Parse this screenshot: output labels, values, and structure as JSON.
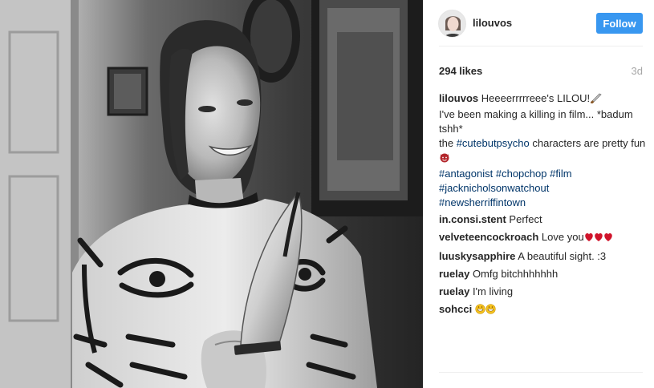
{
  "author": {
    "username": "lilouvos",
    "follow_label": "Follow"
  },
  "post": {
    "likes": "294 likes",
    "age": "3d"
  },
  "caption": {
    "username": "lilouvos",
    "line1": "Heeeerrrrreee's LILOU!",
    "line2": "I've been making a killing in film... *badum tshh*",
    "line3_pre": "the ",
    "line3_tag": "#cutebutpsycho",
    "line3_post": " characters are pretty fun",
    "tags": [
      "#antagonist",
      "#chopchop",
      "#film",
      "#jacknicholsonwatchout",
      "#newsherriffintown"
    ]
  },
  "comments": [
    {
      "user": "in.consi.stent",
      "text": "Perfect"
    },
    {
      "user": "velveteencockroach",
      "text": "Love you"
    },
    {
      "user": "luuskysapphire",
      "text": "A beautiful sight. :3"
    },
    {
      "user": "ruelay",
      "text": "Omfg bitchhhhhhh"
    },
    {
      "user": "ruelay",
      "text": "I'm living"
    },
    {
      "user": "sohcci",
      "text": ""
    }
  ],
  "icons": {
    "knife": "knife-emoji-icon",
    "devil": "devil-emoji-icon",
    "hearts": "hearts-emoji-icon",
    "grin": "grin-emoji-icon"
  },
  "colors": {
    "follow_bg": "#3897f0",
    "hashtag": "#003569",
    "muted": "#a7a7a7"
  }
}
